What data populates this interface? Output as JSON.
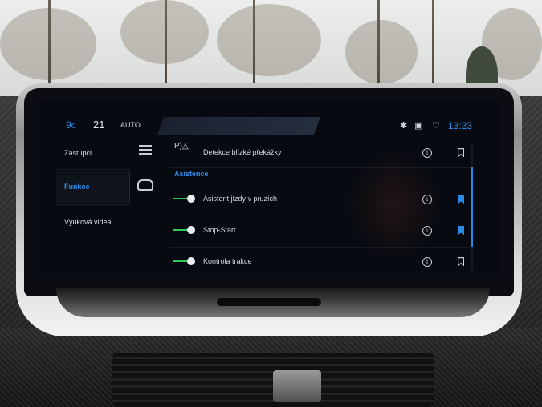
{
  "status_bar": {
    "temp": "9c",
    "num": "21",
    "mode": "AUTO",
    "clock": "13:23",
    "icons": [
      "bluetooth-icon",
      "car-connect-icon",
      "signal-icon"
    ]
  },
  "sidebar": {
    "items": [
      {
        "label": "Zástupci",
        "active": false
      },
      {
        "label": "Funkce",
        "active": true
      },
      {
        "label": "Výuková videa",
        "active": false
      }
    ]
  },
  "content": {
    "rows": [
      {
        "label": "Detekce blízké překážky",
        "icon": "proximity-sensor-icon",
        "bookmarked": false
      },
      {
        "label": "Asistent jízdy v pruzích",
        "toggle_on": true,
        "bookmarked": true
      },
      {
        "label": "Stop-Start",
        "toggle_on": true,
        "bookmarked": true
      },
      {
        "label": "Kontrola trakce",
        "toggle_on": true,
        "bookmarked": false
      }
    ],
    "section_title": "Asistence"
  },
  "colors": {
    "accent": "#2a8ae6",
    "toggle_on": "#34c759",
    "bookmark_on": "#2a8ae6",
    "bookmark_off": "#c9ccd2"
  }
}
